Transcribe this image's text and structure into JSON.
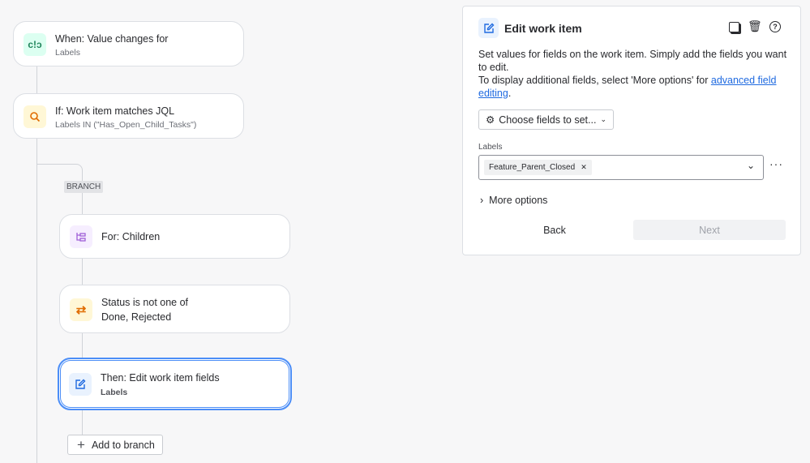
{
  "flow": {
    "trigger": {
      "title": "When: Value changes for",
      "subtitle": "Labels",
      "icon": "trigger-icon"
    },
    "condition": {
      "title": "If: Work item matches JQL",
      "subtitle": "Labels IN (\"Has_Open_Child_Tasks\")",
      "icon": "search-icon"
    },
    "branch_label": "BRANCH",
    "branch": {
      "title": "For: Children",
      "icon": "hierarchy-icon"
    },
    "status": {
      "line1": "Status is not one of",
      "line2": "Done, Rejected",
      "icon": "transition-icon"
    },
    "action": {
      "title": "Then: Edit work item fields",
      "subtitle": "Labels",
      "icon": "edit-icon"
    },
    "add_to_branch": "Add to branch"
  },
  "panel": {
    "title": "Edit work item",
    "desc1": "Set values for fields on the work item. Simply add the fields you want to edit.",
    "desc2": "To display additional fields, select 'More options' for ",
    "link": "advanced field editing",
    "desc2_end": ".",
    "choose_fields": "Choose fields to set...",
    "labels_label": "Labels",
    "tag": "Feature_Parent_Closed",
    "more_options": "More options",
    "back": "Back",
    "next": "Next"
  },
  "colors": {
    "accent": "#1f6ae0",
    "selected_border": "#4c8ef7"
  }
}
